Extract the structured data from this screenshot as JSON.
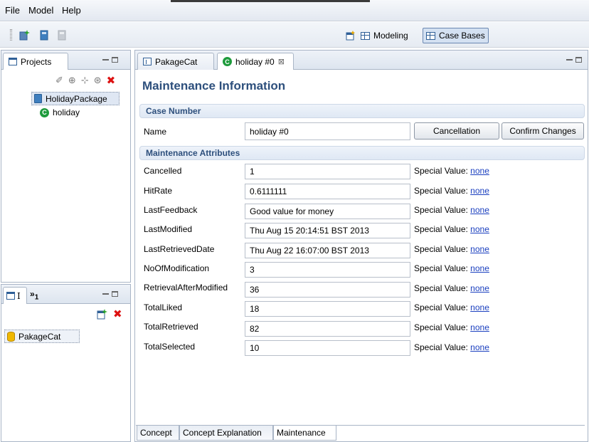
{
  "menubar": {
    "items": [
      "File",
      "Model",
      "Help"
    ]
  },
  "toolbar": {
    "icons": [
      "new-project-icon",
      "book-icon",
      "disabled-book-icon"
    ],
    "perspectives": [
      {
        "label": "Modeling",
        "active": false
      },
      {
        "label": "Case Bases",
        "active": true
      }
    ]
  },
  "projects_view": {
    "tab_label": "Projects",
    "toolbar_icons": [
      "pin-icon",
      "add-concept-icon",
      "add-attribute-icon",
      "add-case-icon",
      "delete-icon"
    ],
    "tree": [
      {
        "label": "HolidayPackage",
        "icon": "book-icon",
        "selected": true
      },
      {
        "label": "holiday",
        "icon": "concept-icon",
        "selected": false
      }
    ]
  },
  "casebase_view": {
    "tab_label": "I",
    "overflow_label": "»",
    "overflow_count": "1",
    "items": [
      {
        "label": "PakageCat",
        "icon": "database-icon"
      }
    ]
  },
  "editor": {
    "tabs": [
      {
        "label": "PakageCat",
        "active": false
      },
      {
        "label": "holiday #0",
        "active": true,
        "close": "⊠"
      }
    ],
    "title": "Maintenance Information",
    "case_section": "Case Number",
    "name_label": "Name",
    "name_value": "holiday #0",
    "buttons": {
      "cancellation": "Cancellation",
      "confirm": "Confirm Changes"
    },
    "attr_section": "Maintenance Attributes",
    "special_value_label": "Special Value:",
    "attributes": [
      {
        "label": "Cancelled",
        "value": "1",
        "special": "none"
      },
      {
        "label": "HitRate",
        "value": "0.6111111",
        "special": "none"
      },
      {
        "label": "LastFeedback",
        "value": "Good value for money",
        "special": "none"
      },
      {
        "label": "LastModified",
        "value": "Thu Aug 15 20:14:51 BST 2013",
        "special": "none"
      },
      {
        "label": "LastRetrievedDate",
        "value": "Thu Aug 22 16:07:00 BST 2013",
        "special": "none"
      },
      {
        "label": "NoOfModification",
        "value": "3",
        "special": "none"
      },
      {
        "label": "RetrievalAfterModified",
        "value": "36",
        "special": "none"
      },
      {
        "label": "TotalLiked",
        "value": "18",
        "special": "none"
      },
      {
        "label": "TotalRetrieved",
        "value": "82",
        "special": "none"
      },
      {
        "label": "TotalSelected",
        "value": "10",
        "special": "none"
      }
    ],
    "bottom_tabs": [
      {
        "label": "Concept",
        "active": false
      },
      {
        "label": "Concept Explanation",
        "active": false
      },
      {
        "label": "Maintenance",
        "active": true
      }
    ]
  }
}
